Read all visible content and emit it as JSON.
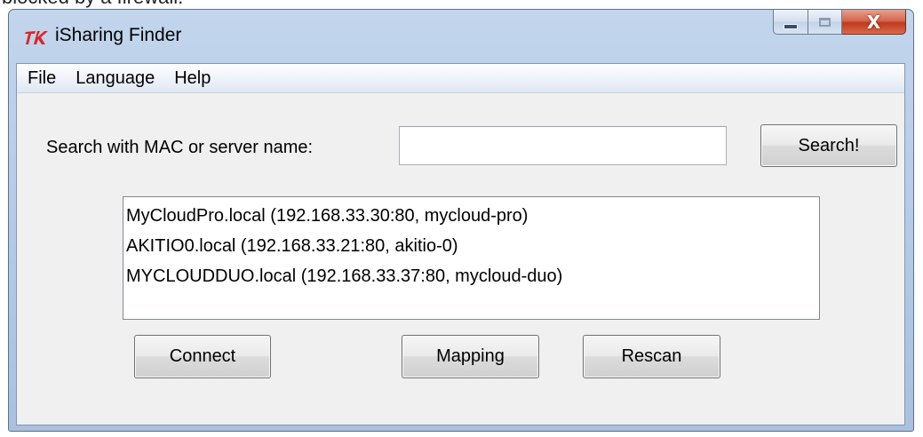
{
  "backdrop": {
    "partial_text": "blocked by a firewall."
  },
  "window": {
    "title": "iSharing Finder",
    "icon": "tk-feather-icon",
    "caption": {
      "minimize_icon": "minimize-icon",
      "maximize_icon": "maximize-icon",
      "close_icon": "close-icon",
      "close_glyph": "X"
    }
  },
  "menu": {
    "items": [
      "File",
      "Language",
      "Help"
    ]
  },
  "search": {
    "label": "Search with MAC or server name:",
    "value": "",
    "placeholder": "",
    "button_label": "Search!"
  },
  "servers": {
    "items": [
      "MyCloudPro.local (192.168.33.30:80, mycloud-pro)",
      "AKITIO0.local (192.168.33.21:80, akitio-0)",
      "MYCLOUDDUO.local (192.168.33.37:80, mycloud-duo)"
    ]
  },
  "actions": {
    "connect_label": "Connect",
    "mapping_label": "Mapping",
    "rescan_label": "Rescan"
  },
  "colors": {
    "title_bar": "#b7cde8",
    "close_button": "#c0391d",
    "client_bg": "#f0f0f0",
    "app_icon_red": "#d9262a"
  }
}
